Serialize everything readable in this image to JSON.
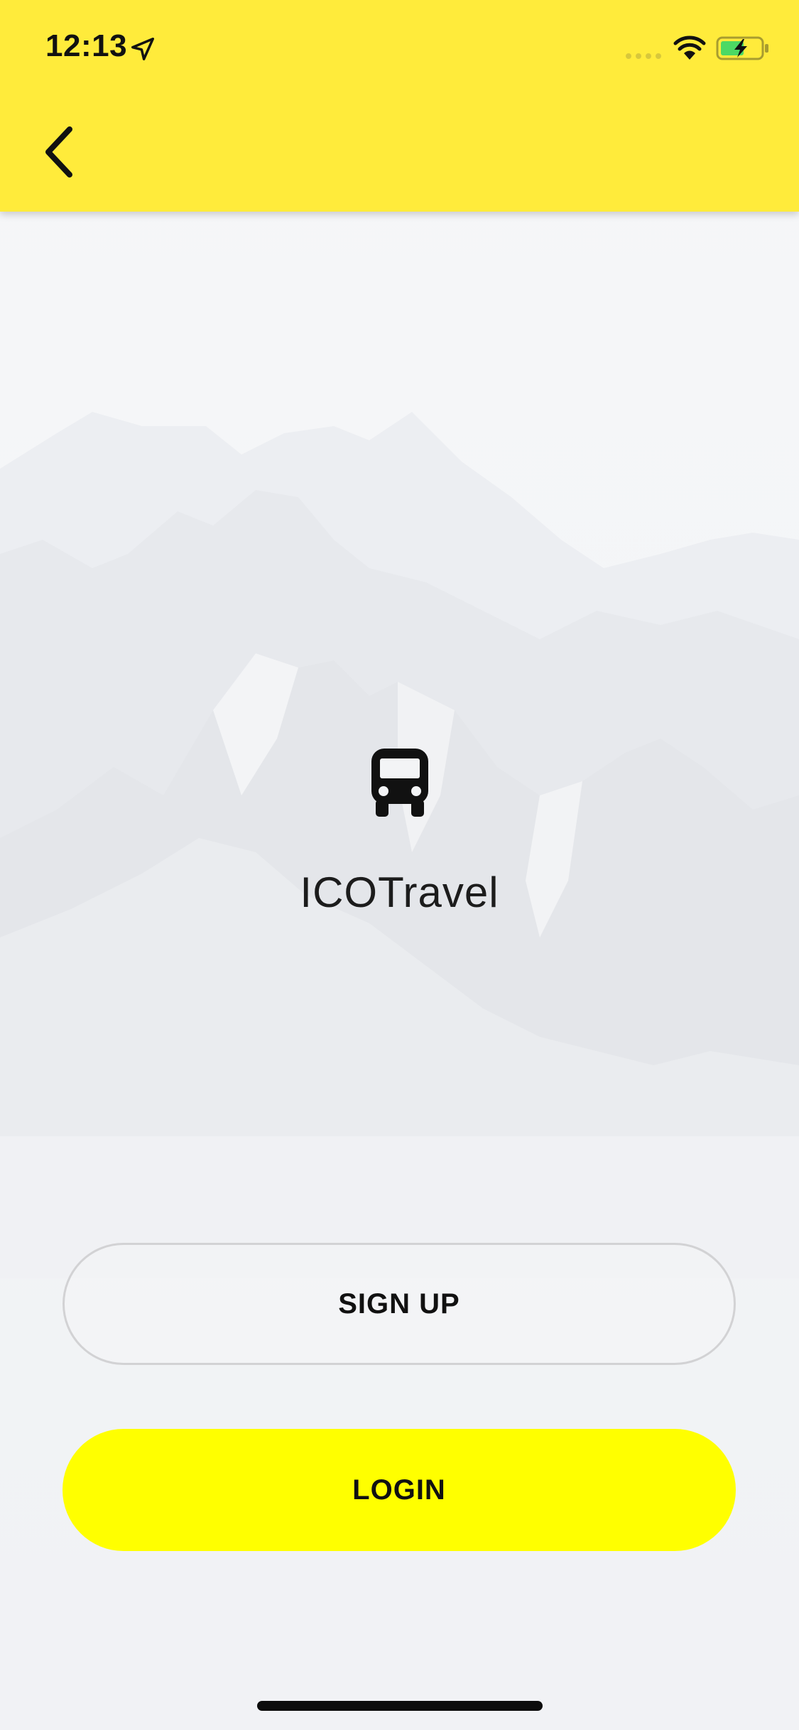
{
  "status_bar": {
    "time": "12:13"
  },
  "icons": {
    "location": "location-arrow-icon",
    "signal": "cellular-signal-icon",
    "wifi": "wifi-icon",
    "battery": "battery-charging-icon",
    "back": "chevron-left-icon",
    "bus": "bus-icon"
  },
  "colors": {
    "header": "#ffeb3b",
    "login_button": "#ffff00",
    "battery_fill": "#4cd964"
  },
  "brand": {
    "name": "ICOTravel"
  },
  "buttons": {
    "signup_label": "SIGN UP",
    "login_label": "LOGIN"
  }
}
